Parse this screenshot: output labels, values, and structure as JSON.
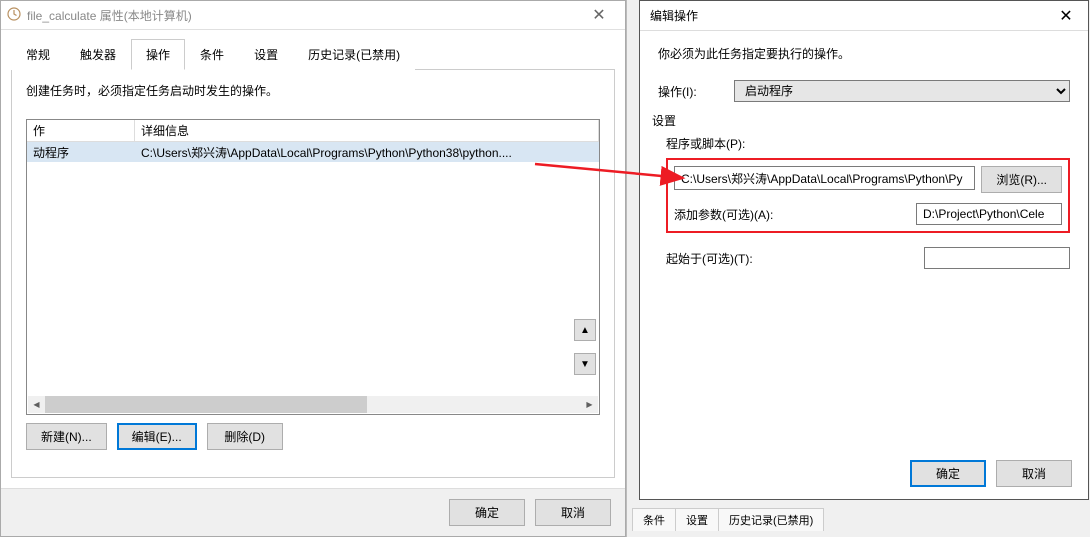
{
  "leftDialog": {
    "title": "file_calculate 属性(本地计算机)",
    "tabs": [
      "常规",
      "触发器",
      "操作",
      "条件",
      "设置",
      "历史记录(已禁用)"
    ],
    "activeTab": 2,
    "instruction": "创建任务时，必须指定任务启动时发生的操作。",
    "table": {
      "headers": {
        "op": "作",
        "detail": "详细信息"
      },
      "rows": [
        {
          "op": "动程序",
          "detail": "C:\\Users\\郑兴涛\\AppData\\Local\\Programs\\Python\\Python38\\python...."
        }
      ]
    },
    "buttons": {
      "new": "新建(N)...",
      "edit": "编辑(E)...",
      "delete": "删除(D)"
    },
    "footer": {
      "ok": "确定",
      "cancel": "取消"
    }
  },
  "rightDialog": {
    "title": "编辑操作",
    "instruction": "你必须为此任务指定要执行的操作。",
    "actionLabel": "操作(I):",
    "actionValue": "启动程序",
    "settingsLabel": "设置",
    "scriptLabel": "程序或脚本(P):",
    "scriptValue": "C:\\Users\\郑兴涛\\AppData\\Local\\Programs\\Python\\Py",
    "browseLabel": "浏览(R)...",
    "argsLabel": "添加参数(可选)(A):",
    "argsValue": "D:\\Project\\Python\\Cele",
    "startInLabel": "起始于(可选)(T):",
    "startInValue": "",
    "footer": {
      "ok": "确定",
      "cancel": "取消"
    }
  },
  "bgTabs": [
    "条件",
    "设置",
    "历史记录(已禁用)"
  ],
  "icons": {
    "up": "▲",
    "down": "▼",
    "left": "◀",
    "right": "▶",
    "close": "✕"
  }
}
